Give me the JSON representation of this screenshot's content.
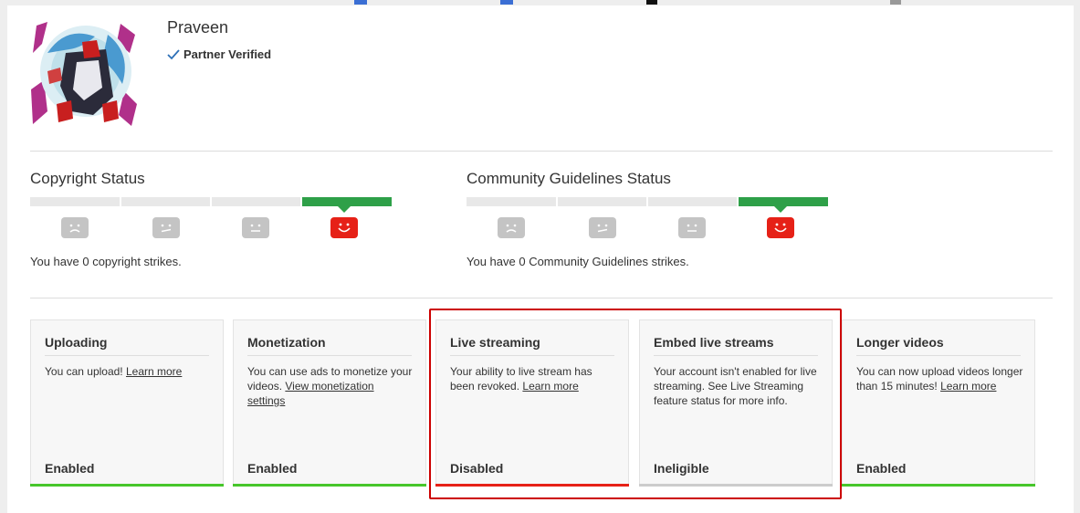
{
  "channel": {
    "name": "Praveen",
    "verified_label": "Partner Verified",
    "avatar_icon": "channel-avatar"
  },
  "copyright": {
    "title": "Copyright Status",
    "summary": "You have 0 copyright strikes.",
    "active_level": 4
  },
  "community": {
    "title": "Community Guidelines Status",
    "summary": "You have 0 Community Guidelines strikes.",
    "active_level": 4
  },
  "colors": {
    "active": "#2ea048",
    "enabled": "#47c62b",
    "disabled": "#e62117",
    "ineligible": "#cccccc",
    "highlight": "#cc0000"
  },
  "features": [
    {
      "title": "Uploading",
      "text": "You can upload!",
      "link": "Learn more",
      "text_after": "",
      "status": "Enabled"
    },
    {
      "title": "Monetization",
      "text": "You can use ads to monetize your videos.",
      "link": "View monetization settings",
      "text_after": "",
      "status": "Enabled"
    },
    {
      "title": "Live streaming",
      "text": "Your ability to live stream has been revoked.",
      "link": "Learn more",
      "text_after": "",
      "status": "Disabled"
    },
    {
      "title": "Embed live streams",
      "text": "Your account isn't enabled for live streaming. See Live Streaming feature status for more info.",
      "link": "",
      "text_after": "",
      "status": "Ineligible"
    },
    {
      "title": "Longer videos",
      "text": "You can now upload videos longer than 15 minutes!",
      "link": "Learn more",
      "text_after": "",
      "status": "Enabled"
    }
  ]
}
